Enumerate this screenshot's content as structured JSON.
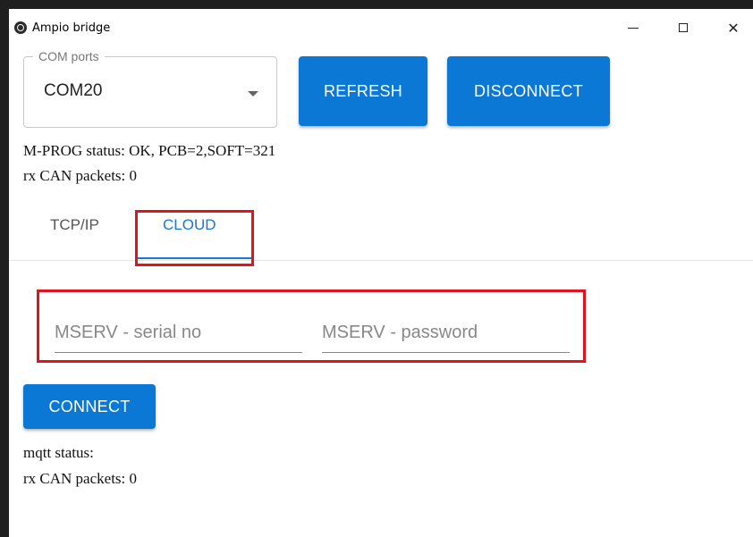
{
  "window": {
    "title": "Ampio bridge",
    "controls": {
      "minimize": "",
      "maximize": "",
      "close": "✕"
    }
  },
  "com": {
    "legend": "COM ports",
    "selected": "COM20"
  },
  "buttons": {
    "refresh": "REFRESH",
    "disconnect": "DISCONNECT",
    "connect": "CONNECT"
  },
  "status": {
    "mprog": "M-PROG status: OK, PCB=2,SOFT=321",
    "rx_can_top": "rx CAN packets: 0",
    "mqtt": "mqtt status:",
    "rx_can_bottom": "rx CAN packets: 0"
  },
  "tabs": [
    {
      "label": "TCP/IP",
      "active": false
    },
    {
      "label": "CLOUD",
      "active": true
    }
  ],
  "fields": {
    "serial_placeholder": "MSERV - serial no",
    "password_placeholder": "MSERV - password"
  },
  "colors": {
    "accent": "#0a78d4",
    "tab_active": "#1976d2",
    "highlight": "#e0141e"
  },
  "icons": {
    "app": "ampio-app-icon",
    "minimize": "minimize-icon",
    "maximize": "maximize-icon",
    "close": "close-icon",
    "dropdown": "chevron-down-icon"
  }
}
